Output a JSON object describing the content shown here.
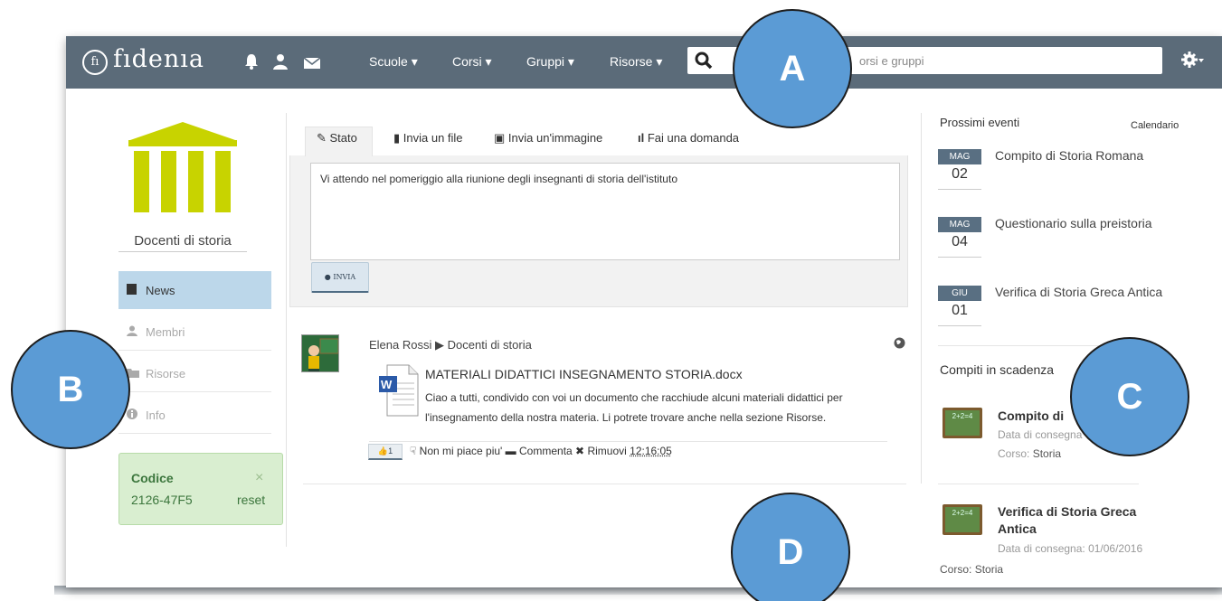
{
  "navbar": {
    "logo_mark": "fı",
    "logo_text": "fıdenıa",
    "menus": [
      "Scuole ▾",
      "Corsi ▾",
      "Gruppi ▾",
      "Risorse ▾"
    ],
    "search_placeholder": "orsi e gruppi",
    "icons": [
      "bell-icon",
      "user-icon",
      "mail-icon",
      "search-icon",
      "gear-icon"
    ]
  },
  "sidebar": {
    "group_name": "Docenti di storia",
    "items": [
      {
        "label": "News",
        "icon": "newspaper-icon",
        "active": true
      },
      {
        "label": "Membri",
        "icon": "user-icon",
        "active": false
      },
      {
        "label": "Risorse",
        "icon": "folder-icon",
        "active": false
      },
      {
        "label": "Info",
        "icon": "info-icon",
        "active": false
      }
    ],
    "code": {
      "label": "Codice",
      "value": "2126-47F5",
      "reset": "reset",
      "close": "×"
    }
  },
  "composer": {
    "tabs": [
      "Stato",
      "Invia un file",
      "Invia un'immagine",
      "Fai una domanda"
    ],
    "text": "Vi attendo nel pomeriggio alla riunione degli insegnanti di storia dell'istituto",
    "send_label": "INVIA"
  },
  "post": {
    "author": "Elena Rossi",
    "arrow": "▶",
    "group": "Docenti di storia",
    "doc_title": "MATERIALI DIDATTICI INSEGNAMENTO STORIA.docx",
    "doc_text": "Ciao a tutti, condivido con voi un documento che racchiude alcuni materiali didattici per l'insegnamento della nostra materia. Li potrete trovare anche nella sezione Risorse.",
    "like_count": "1",
    "unlike": "Non mi piace piu'",
    "comment": "Commenta",
    "remove": "Rimuovi",
    "time": "12:16:05"
  },
  "events": {
    "title": "Prossimi eventi",
    "calendar_link": "Calendario",
    "items": [
      {
        "month": "MAG",
        "day": "02",
        "title": "Compito di Storia Romana"
      },
      {
        "month": "MAG",
        "day": "04",
        "title": "Questionario sulla preistoria"
      },
      {
        "month": "GIU",
        "day": "01",
        "title": "Verifica di Storia Greca Antica"
      }
    ]
  },
  "tasks": {
    "title": "Compiti in scadenza",
    "items": [
      {
        "title": "Compito di",
        "meta": "Data di consegna",
        "course_label": "Corso:",
        "course": "Storia",
        "board": "2+2=4"
      },
      {
        "title": "Verifica di Storia Greca Antica",
        "meta": "Data di consegna: 01/06/2016",
        "course_label": "Corso:",
        "course": "Storia",
        "board": "2+2=4"
      }
    ]
  },
  "callouts": [
    "A",
    "B",
    "C",
    "D"
  ]
}
